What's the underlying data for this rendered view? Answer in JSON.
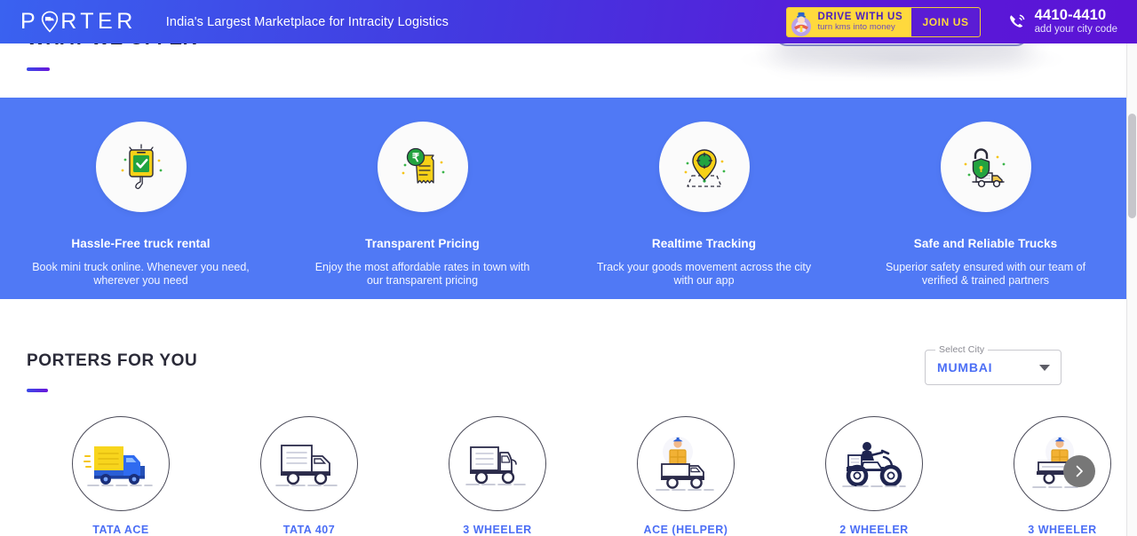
{
  "navbar": {
    "logo_text": "PORTER",
    "logo_icon": "map-pin-truck-icon",
    "tagline": "India's Largest Marketplace for Intracity Logistics",
    "drive": {
      "title": "DRIVE WITH US",
      "subtitle": "turn kms into money",
      "join_label": "JOIN US",
      "avatar_icon": "driver-avatar-icon"
    },
    "phone": {
      "icon": "phone-call-icon",
      "number": "4410-4410",
      "note": "add your city code"
    },
    "colors": {
      "gradient_start": "#3a62f0",
      "gradient_end": "#5b14d6",
      "accent_yellow": "#ffd93d"
    }
  },
  "offers_section": {
    "title": "WHAT WE OFFER",
    "background": "#5079f5",
    "items": [
      {
        "icon": "mobile-checkmark-icon",
        "title": "Hassle-Free truck rental",
        "desc": "Book mini truck online. Whenever you need, wherever you need"
      },
      {
        "icon": "rupee-receipt-icon",
        "title": "Transparent Pricing",
        "desc": "Enjoy the most affordable rates in town with our transparent pricing"
      },
      {
        "icon": "map-pin-tracking-icon",
        "title": "Realtime Tracking",
        "desc": "Track your goods movement across the city with our app"
      },
      {
        "icon": "lock-truck-icon",
        "title": "Safe and Reliable Trucks",
        "desc": "Superior safety ensured with our team of verified & trained partners"
      }
    ]
  },
  "porters_section": {
    "title": "PORTERS FOR YOU",
    "city_select": {
      "label": "Select City",
      "value": "MUMBAI",
      "caret_icon": "chevron-down-icon"
    },
    "vehicles": [
      {
        "label": "TATA ACE",
        "icon": "tata-ace-truck-icon",
        "selected": true
      },
      {
        "label": "TATA 407",
        "icon": "tata-407-truck-icon",
        "selected": false
      },
      {
        "label": "3 WHEELER",
        "icon": "three-wheeler-icon",
        "selected": false
      },
      {
        "label": "ACE (HELPER)",
        "icon": "ace-helper-truck-icon",
        "selected": false
      },
      {
        "label": "2 WHEELER",
        "icon": "two-wheeler-bike-icon",
        "selected": false
      },
      {
        "label": "3 WHEELER",
        "icon": "three-wheeler-helper-icon",
        "selected": false
      }
    ],
    "next_arrow_icon": "chevron-right-icon",
    "accent_color": "#4b6ef5"
  }
}
